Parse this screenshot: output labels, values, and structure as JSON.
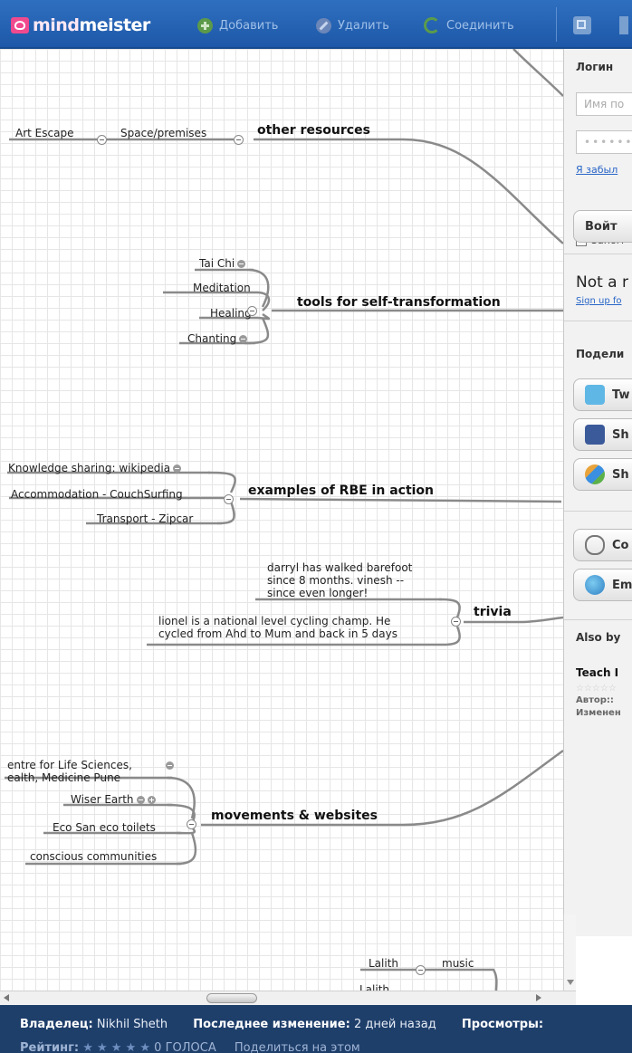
{
  "toolbar": {
    "logo_mind": "mind",
    "logo_meister": "meister",
    "add_label": "Добавить",
    "delete_label": "Удалить",
    "connect_label": "Соединить"
  },
  "map": {
    "nodes": {
      "art_escape": "Art Escape",
      "space_premises": "Space/premises",
      "other_resources": "other resources",
      "tai_chi": "Tai Chi",
      "meditation": "Meditation",
      "healing": "Healing",
      "chanting": "Chanting",
      "tools": "tools for self-transformation",
      "knowledge_sharing": "Knowledge sharing: wikipedia",
      "accommodation": "Accommodation - CouchSurfing",
      "transport": "Transport - Zipcar",
      "rbe": "examples of RBE in action",
      "darryl": "darryl has walked barefoot\nsince 8 months. vinesh --\nsince even longer!",
      "lionel": "lionel is a national level cycling champ. He\ncycled from Ahd to Mum and back in 5 days",
      "trivia": "trivia",
      "centre": "entre for Life Sciences,\nealth, Medicine Pune",
      "wiser_earth": "Wiser Earth",
      "eco_san": "Eco San eco toilets",
      "conscious": "conscious communities",
      "movements": "movements & websites",
      "lalith1": "Lalith",
      "music": "music",
      "lalith2": "Lalith"
    }
  },
  "panel": {
    "login_title": "Логин",
    "username_placeholder": "Имя по",
    "password_placeholder": "••••••",
    "forgot_link": "Я забыл",
    "remember_label": "Запом",
    "login_button": "Войт",
    "not_a": "Not a r",
    "signup_link": "Sign up fo",
    "share_title": "Подели",
    "twitter_label": "Tw",
    "facebook_label": "Sh",
    "google_label": "Sh",
    "copy_label": "Co",
    "email_label": "Em",
    "also_by": "Also by",
    "teach_title": "Teach I",
    "author_label": "Автор::",
    "changed_label": "Изменен"
  },
  "footer": {
    "owner_label": "Владелец:",
    "owner_value": "Nikhil Sheth",
    "last_change_label": "Последнее изменение:",
    "last_change_value": "2 дней назад",
    "views_label": "Просмотры:",
    "rating_label": "Рейтинг:",
    "votes_text": "0 ГОЛОСА",
    "tail_text": "Поделиться на этом"
  },
  "colors": {
    "toolbar_bg": "#2468b8",
    "footer_bg": "#1f3f6b",
    "link_color": "#2a66c8"
  }
}
